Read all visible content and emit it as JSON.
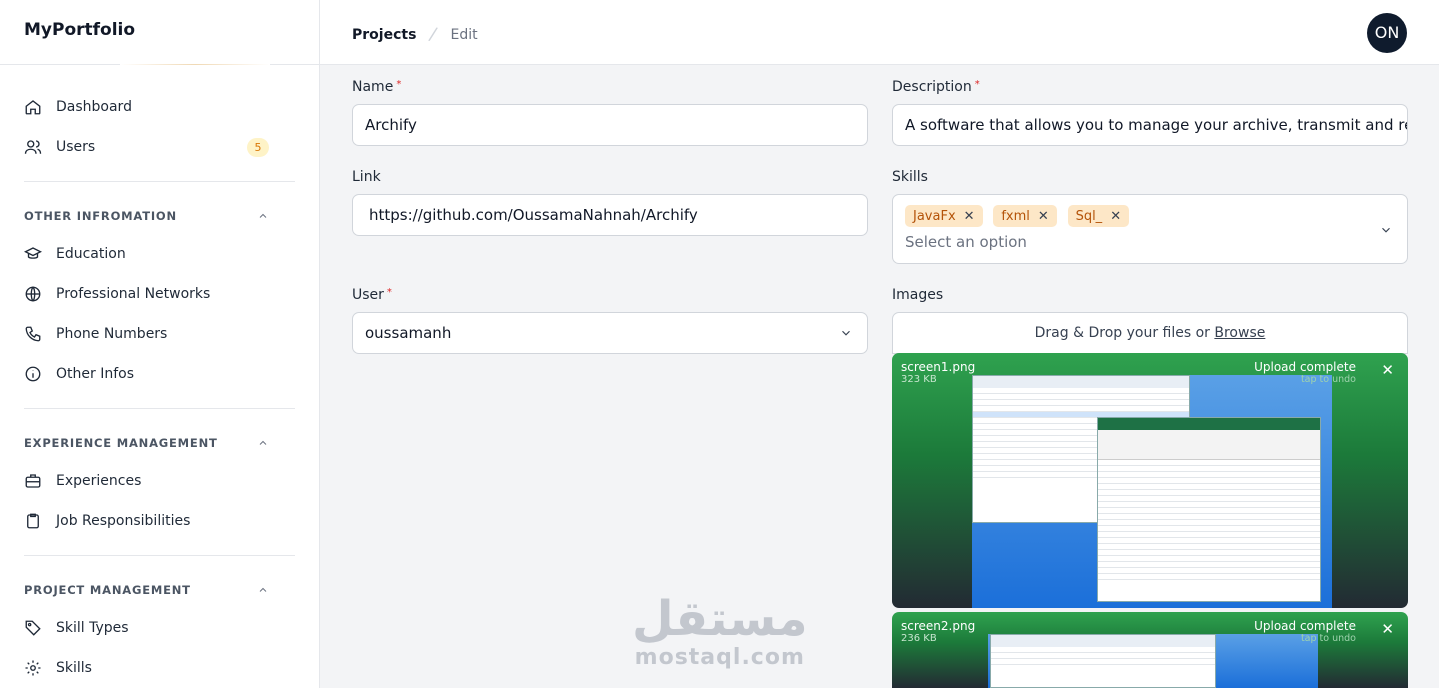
{
  "app": {
    "brand": "MyPortfolio"
  },
  "sidebar": {
    "top_items": [
      {
        "label": "Dashboard",
        "icon": "home-icon"
      },
      {
        "label": "Users",
        "icon": "users-icon",
        "badge": "5"
      }
    ],
    "groups": [
      {
        "title": "OTHER INFROMATION",
        "items": [
          {
            "label": "Education",
            "icon": "graduation-cap-icon"
          },
          {
            "label": "Professional Networks",
            "icon": "globe-icon"
          },
          {
            "label": "Phone Numbers",
            "icon": "phone-icon"
          },
          {
            "label": "Other Infos",
            "icon": "info-icon"
          }
        ]
      },
      {
        "title": "EXPERIENCE MANAGEMENT",
        "items": [
          {
            "label": "Experiences",
            "icon": "briefcase-icon"
          },
          {
            "label": "Job Responsibilities",
            "icon": "clipboard-icon"
          }
        ]
      },
      {
        "title": "PROJECT MANAGEMENT",
        "items": [
          {
            "label": "Skill Types",
            "icon": "tag-icon"
          },
          {
            "label": "Skills",
            "icon": "gear-icon"
          }
        ]
      }
    ]
  },
  "header": {
    "breadcrumb": [
      "Projects",
      "Edit"
    ],
    "avatar_initials": "ON"
  },
  "form": {
    "name": {
      "label": "Name",
      "value": "Archify"
    },
    "description": {
      "label": "Description",
      "value": "A software that allows you to manage your archive, transmit and re"
    },
    "link": {
      "label": "Link",
      "value": "https://github.com/OussamaNahnah/Archify"
    },
    "skills": {
      "label": "Skills",
      "tags": [
        "JavaFx",
        "fxml",
        "Sql_"
      ],
      "placeholder": "Select an option"
    },
    "user": {
      "label": "User",
      "value": "oussamanh"
    },
    "images": {
      "label": "Images",
      "dropzone_text": "Drag & Drop your files or",
      "browse_label": "Browse",
      "files": [
        {
          "name": "screen1.png",
          "size": "323 KB",
          "status": "Upload complete",
          "undo": "tap to undo"
        },
        {
          "name": "screen2.png",
          "size": "236 KB",
          "status": "Upload complete",
          "undo": "tap to undo"
        }
      ]
    }
  },
  "watermark": {
    "arabic": "مستقل",
    "latin": "mostaql.com"
  },
  "colors": {
    "accent": "#d97706",
    "avatar_bg": "#0f1b2d",
    "upload_green": "#2fa24f",
    "required": "#dc2626"
  }
}
